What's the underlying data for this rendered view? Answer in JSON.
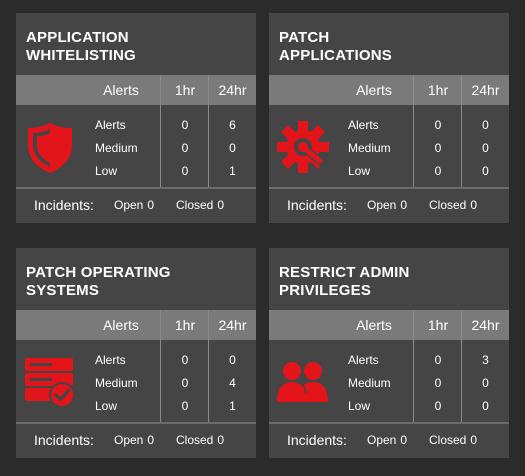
{
  "colors": {
    "accent": "#e3141a",
    "card": "#454545",
    "header": "#7a7a7a",
    "background": "#2b2b2b"
  },
  "table_headers": {
    "alerts": "Alerts",
    "h1": "1hr",
    "h24": "24hr"
  },
  "incidents_label": "Incidents:",
  "open_label": "Open",
  "closed_label": "Closed",
  "cards": [
    {
      "title_line1": "APPLICATION",
      "title_line2": "WHITELISTING",
      "icon": "shield-icon",
      "rows": [
        {
          "label": "Alerts",
          "h1": "0",
          "h24": "6"
        },
        {
          "label": "Medium",
          "h1": "0",
          "h24": "0"
        },
        {
          "label": "Low",
          "h1": "0",
          "h24": "1"
        }
      ],
      "open": "0",
      "closed": "0"
    },
    {
      "title_line1": "PATCH",
      "title_line2": "APPLICATIONS",
      "icon": "gear-wrench-icon",
      "rows": [
        {
          "label": "Alerts",
          "h1": "0",
          "h24": "0"
        },
        {
          "label": "Medium",
          "h1": "0",
          "h24": "0"
        },
        {
          "label": "Low",
          "h1": "0",
          "h24": "0"
        }
      ],
      "open": "0",
      "closed": "0"
    },
    {
      "title_line1": "PATCH OPERATING",
      "title_line2": "SYSTEMS",
      "icon": "server-check-icon",
      "rows": [
        {
          "label": "Alerts",
          "h1": "0",
          "h24": "0"
        },
        {
          "label": "Medium",
          "h1": "0",
          "h24": "4"
        },
        {
          "label": "Low",
          "h1": "0",
          "h24": "1"
        }
      ],
      "open": "0",
      "closed": "0"
    },
    {
      "title_line1": "RESTRICT ADMIN",
      "title_line2": "PRIVILEGES",
      "icon": "users-icon",
      "rows": [
        {
          "label": "Alerts",
          "h1": "0",
          "h24": "3"
        },
        {
          "label": "Medium",
          "h1": "0",
          "h24": "0"
        },
        {
          "label": "Low",
          "h1": "0",
          "h24": "0"
        }
      ],
      "open": "0",
      "closed": "0"
    }
  ]
}
